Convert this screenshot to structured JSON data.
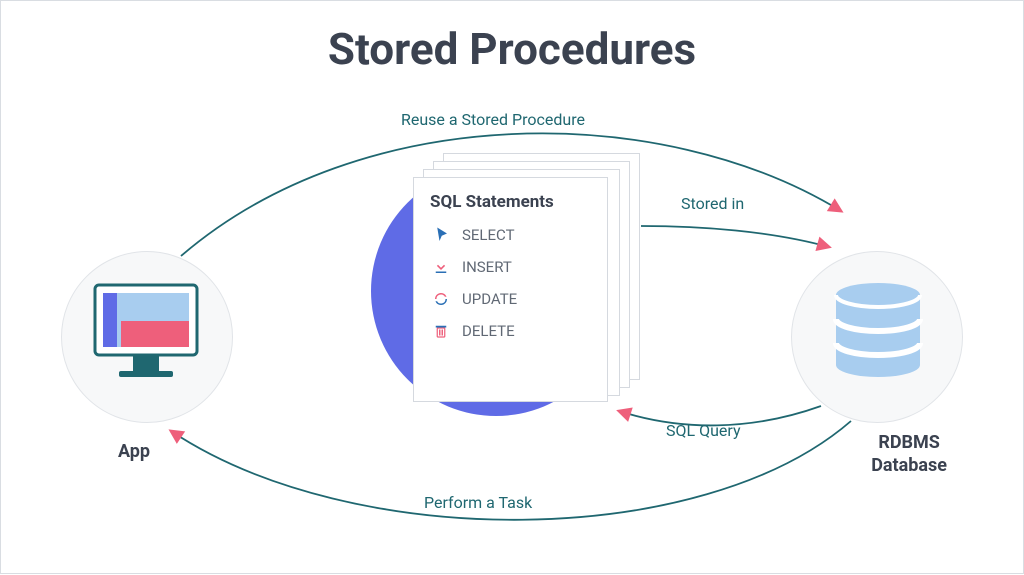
{
  "title": "Stored Procedures",
  "app": {
    "label": "App"
  },
  "db": {
    "label": "RDBMS\nDatabase"
  },
  "sql_card": {
    "heading": "SQL Statements",
    "statements": [
      {
        "icon": "pointer-icon",
        "label": "SELECT"
      },
      {
        "icon": "download-icon",
        "label": "INSERT"
      },
      {
        "icon": "refresh-icon",
        "label": "UPDATE"
      },
      {
        "icon": "trash-icon",
        "label": "DELETE"
      }
    ]
  },
  "arrows": {
    "reuse_label": "Reuse a Stored Procedure",
    "stored_label": "Stored in",
    "query_label": "SQL Query",
    "task_label": "Perform a Task"
  },
  "colors": {
    "teal": "#1f6770",
    "pink": "#ee5f7b",
    "blue": "#5f6be6",
    "light_blue": "#a8cdef"
  }
}
